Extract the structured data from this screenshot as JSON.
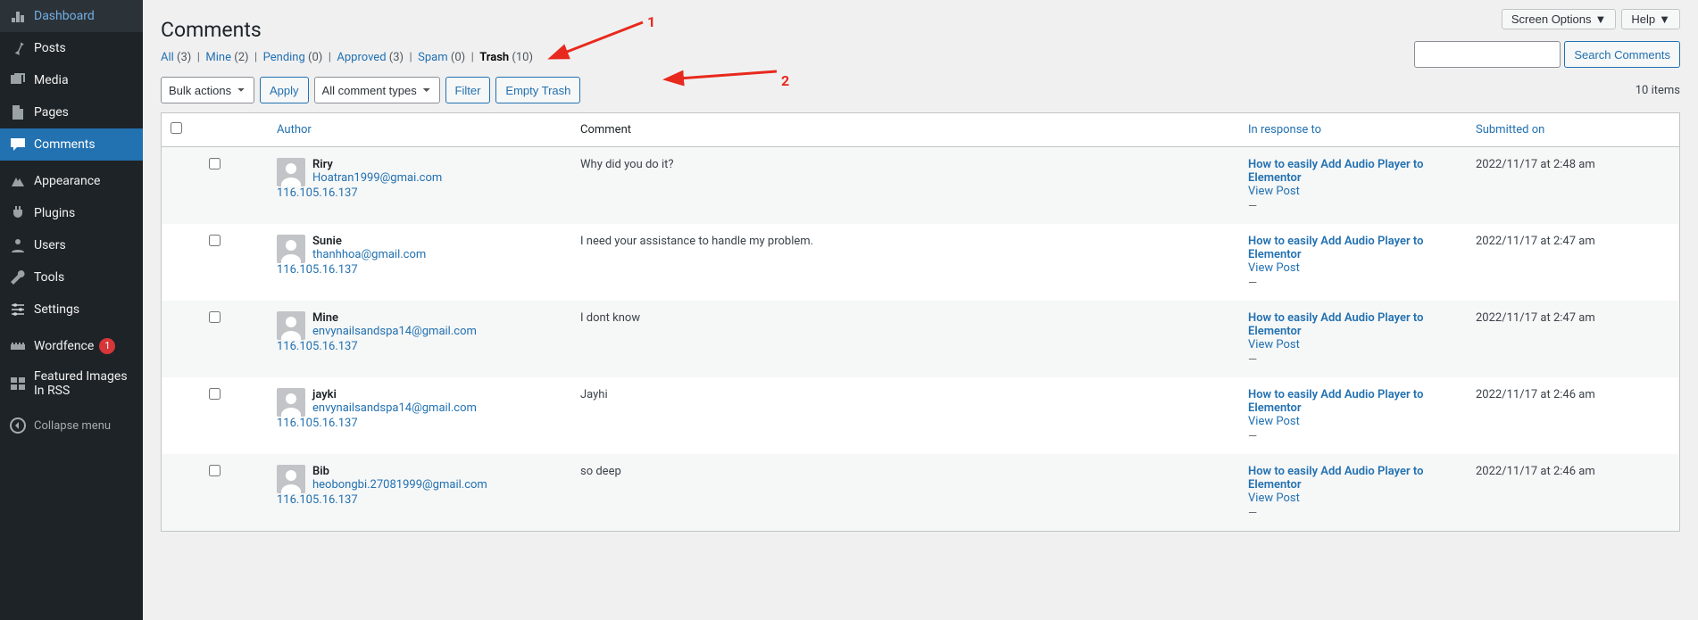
{
  "sidebar": {
    "items": [
      {
        "label": "Dashboard",
        "icon": "dashboard"
      },
      {
        "label": "Posts",
        "icon": "pin"
      },
      {
        "label": "Media",
        "icon": "media"
      },
      {
        "label": "Pages",
        "icon": "pages"
      },
      {
        "label": "Comments",
        "icon": "comments",
        "current": true
      },
      {
        "label": "Appearance",
        "icon": "appearance"
      },
      {
        "label": "Plugins",
        "icon": "plugins"
      },
      {
        "label": "Users",
        "icon": "users"
      },
      {
        "label": "Tools",
        "icon": "tools"
      },
      {
        "label": "Settings",
        "icon": "settings"
      },
      {
        "label": "Wordfence",
        "icon": "wordfence",
        "badge": "1"
      },
      {
        "label": "Featured Images In RSS",
        "icon": "fir"
      }
    ],
    "collapse_label": "Collapse menu"
  },
  "top_buttons": {
    "screen_options": "Screen Options",
    "help": "Help"
  },
  "page_title": "Comments",
  "filters": {
    "all": {
      "label": "All",
      "count": "(3)"
    },
    "mine": {
      "label": "Mine",
      "count": "(2)"
    },
    "pending": {
      "label": "Pending",
      "count": "(0)"
    },
    "approved": {
      "label": "Approved",
      "count": "(3)"
    },
    "spam": {
      "label": "Spam",
      "count": "(0)"
    },
    "trash": {
      "label": "Trash",
      "count": "(10)"
    }
  },
  "bulk_action_label": "Bulk actions",
  "apply_label": "Apply",
  "comment_types_label": "All comment types",
  "filter_label": "Filter",
  "empty_trash_label": "Empty Trash",
  "search_label": "Search Comments",
  "items_count": "10 items",
  "columns": {
    "author": "Author",
    "comment": "Comment",
    "response": "In response to",
    "date": "Submitted on"
  },
  "view_post_label": "View Post",
  "dash": "—",
  "rows": [
    {
      "author_name": "Riry",
      "author_email": "Hoatran1999@gmai.com",
      "author_ip": "116.105.16.137",
      "comment": "Why did you do it?",
      "post_title": "How to easily Add Audio Player to Elementor",
      "date": "2022/11/17 at 2:48 am"
    },
    {
      "author_name": "Sunie",
      "author_email": "thanhhoa@gmail.com",
      "author_ip": "116.105.16.137",
      "comment": "I need your assistance to handle my problem.",
      "post_title": "How to easily Add Audio Player to Elementor",
      "date": "2022/11/17 at 2:47 am"
    },
    {
      "author_name": "Mine",
      "author_email": "envynailsandspa14@gmail.com",
      "author_ip": "116.105.16.137",
      "comment": "I dont know",
      "post_title": "How to easily Add Audio Player to Elementor",
      "date": "2022/11/17 at 2:47 am"
    },
    {
      "author_name": "jayki",
      "author_email": "envynailsandspa14@gmail.com",
      "author_ip": "116.105.16.137",
      "comment": "Jayhi",
      "post_title": "How to easily Add Audio Player to Elementor",
      "date": "2022/11/17 at 2:46 am"
    },
    {
      "author_name": "Bib",
      "author_email": "heobongbi.27081999@gmail.com",
      "author_ip": "116.105.16.137",
      "comment": "so deep",
      "post_title": "How to easily Add Audio Player to Elementor",
      "date": "2022/11/17 at 2:46 am"
    }
  ],
  "annotations": {
    "one": "1",
    "two": "2"
  }
}
